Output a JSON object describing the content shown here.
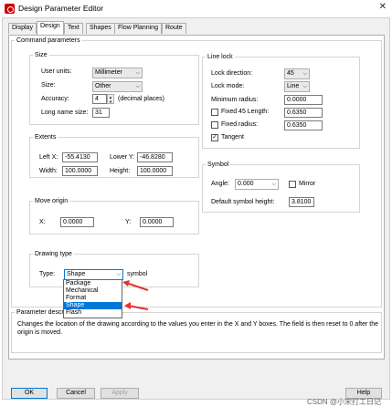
{
  "window": {
    "title": "Design Parameter Editor",
    "close_glyph": "✕"
  },
  "tabs": [
    {
      "label": "Display"
    },
    {
      "label": "Design"
    },
    {
      "label": "Text"
    },
    {
      "label": "Shapes"
    },
    {
      "label": "Flow Planning"
    },
    {
      "label": "Route"
    }
  ],
  "command_parameters": {
    "legend": "Command parameters",
    "size": {
      "legend": "Size",
      "user_units_label": "User units:",
      "user_units_value": "Millimeter",
      "size_label": "Size:",
      "size_value": "Other",
      "accuracy_label": "Accuracy:",
      "accuracy_value": "4",
      "accuracy_note": "(decimal places)",
      "long_name_size_label": "Long name size:",
      "long_name_size_value": "31"
    },
    "extents": {
      "legend": "Extents",
      "left_x_label": "Left X:",
      "left_x_value": "-55.4130",
      "lower_y_label": "Lower Y:",
      "lower_y_value": "-46.8280",
      "width_label": "Width:",
      "width_value": "100.0000",
      "height_label": "Height:",
      "height_value": "100.0000"
    },
    "move_origin": {
      "legend": "Move origin",
      "x_label": "X:",
      "x_value": "0.0000",
      "y_label": "Y:",
      "y_value": "0.0000"
    },
    "drawing_type": {
      "legend": "Drawing type",
      "type_label": "Type:",
      "type_value": "Shape",
      "suffix": "symbol",
      "options": [
        "Package",
        "Mechanical",
        "Format",
        "Shape",
        "Flash"
      ],
      "selected_index": 3
    },
    "line_lock": {
      "legend": "Line lock",
      "lock_direction_label": "Lock direction:",
      "lock_direction_value": "45",
      "lock_mode_label": "Lock mode:",
      "lock_mode_value": "Line",
      "minimum_radius_label": "Minimum radius:",
      "minimum_radius_value": "0.0000",
      "fixed45_label": "Fixed 45 Length:",
      "fixed45_value": "0.6350",
      "fixed45_checked": false,
      "fixed_radius_label": "Fixed radius:",
      "fixed_radius_value": "0.6350",
      "fixed_radius_checked": false,
      "tangent_label": "Tangent",
      "tangent_checked": true
    },
    "symbol": {
      "legend": "Symbol",
      "angle_label": "Angle:",
      "angle_value": "0.000",
      "mirror_label": "Mirror",
      "mirror_checked": false,
      "default_height_label": "Default symbol height:",
      "default_height_value": "3.8100"
    }
  },
  "parameter_description": {
    "legend": "Parameter description",
    "text": "Changes the location of the drawing according to the values you enter in the X and Y boxes. The field is then reset to 0 after the origin is moved."
  },
  "buttons": {
    "ok": "OK",
    "cancel": "Cancel",
    "apply": "Apply",
    "help": "Help"
  },
  "watermark": "CSDN @小宋打工日记",
  "colors": {
    "accent": "#0078d7",
    "arrow": "#e2342b",
    "app_icon": "#cc0000"
  }
}
